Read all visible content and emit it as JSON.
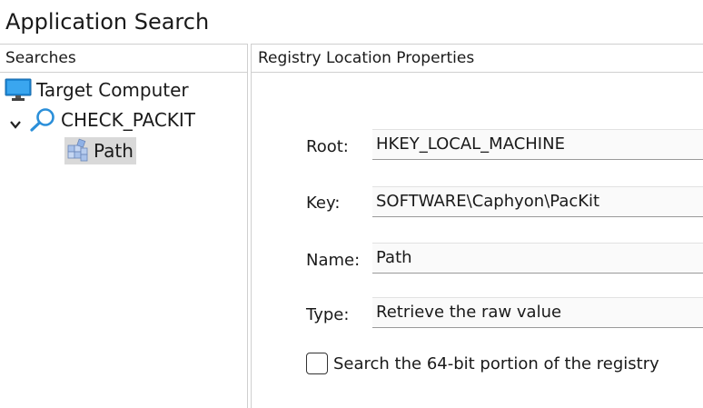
{
  "window": {
    "title": "Application Search"
  },
  "left_panel": {
    "header": "Searches",
    "tree": {
      "root": {
        "label": "Target Computer",
        "icon": "monitor-icon"
      },
      "search": {
        "label": "CHECK_PACKIT",
        "icon": "magnifier-icon",
        "expanded": true
      },
      "item": {
        "label": "Path",
        "icon": "registry-icon",
        "selected": true
      }
    }
  },
  "right_panel": {
    "header": "Registry Location Properties",
    "fields": {
      "root": {
        "label": "Root:",
        "value": "HKEY_LOCAL_MACHINE"
      },
      "key": {
        "label": "Key:",
        "value": "SOFTWARE\\Caphyon\\PacKit"
      },
      "name": {
        "label": "Name:",
        "value": "Path"
      },
      "type": {
        "label": "Type:",
        "value": "Retrieve the raw value"
      }
    },
    "checkbox": {
      "label": "Search the 64-bit portion of the registry",
      "checked": false
    }
  },
  "colors": {
    "monitor": "#1e88d6",
    "magnifier": "#2b8fd9",
    "selection": "#d9d9d9"
  }
}
